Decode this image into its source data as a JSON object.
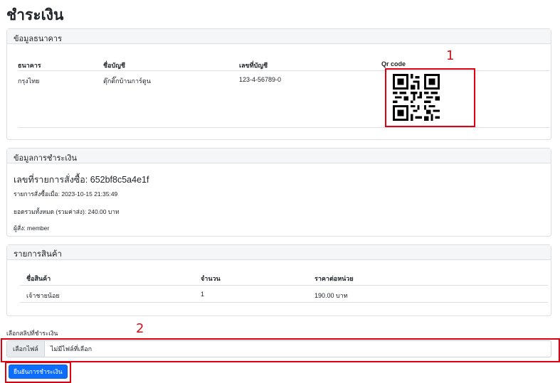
{
  "page": {
    "title": "ชำระเงิน"
  },
  "bank": {
    "header": "ข้อมูลธนาคาร",
    "columns": [
      "ธนาคาร",
      "ชื่อบัญชี",
      "เลขที่บัญชี",
      "Qr code"
    ],
    "row": {
      "bank": "กรุงไทย",
      "account_name": "ตุ๊กติ๊กบ้านการ์ตูน",
      "account_no": "123-4-56789-0"
    }
  },
  "payment": {
    "header": "ข้อมูลการชำระเงิน",
    "order_no": "เลขที่รายการสั่งซื้อ: 652bf8c5a4e1f",
    "order_date": "รายการสั่งซื้อเมื่อ: 2023-10-15 21:35:49",
    "total": "ยอดรวมทั้งหมด (รวมค่าส่ง): 240.00 บาท",
    "buyer": "ผู้สั่ง: member"
  },
  "products": {
    "header": "รายการสินค้า",
    "columns": [
      "ชื่อสินค้า",
      "จำนวน",
      "ราคาต่อหน่วย"
    ],
    "rows": [
      {
        "name": "เจ้าชายน้อย",
        "qty": "1",
        "price": "190.00 บาท"
      }
    ]
  },
  "upload": {
    "label": "เลือกสลิปที่ชำระเงิน",
    "button": "เลือกไฟล์",
    "status": "ไม่มีไฟล์ที่เลือก"
  },
  "submit": {
    "label": "ยืนยันการชำระเงิน"
  },
  "annotations": {
    "one": "1",
    "two": "2",
    "color": "#e0000f"
  }
}
